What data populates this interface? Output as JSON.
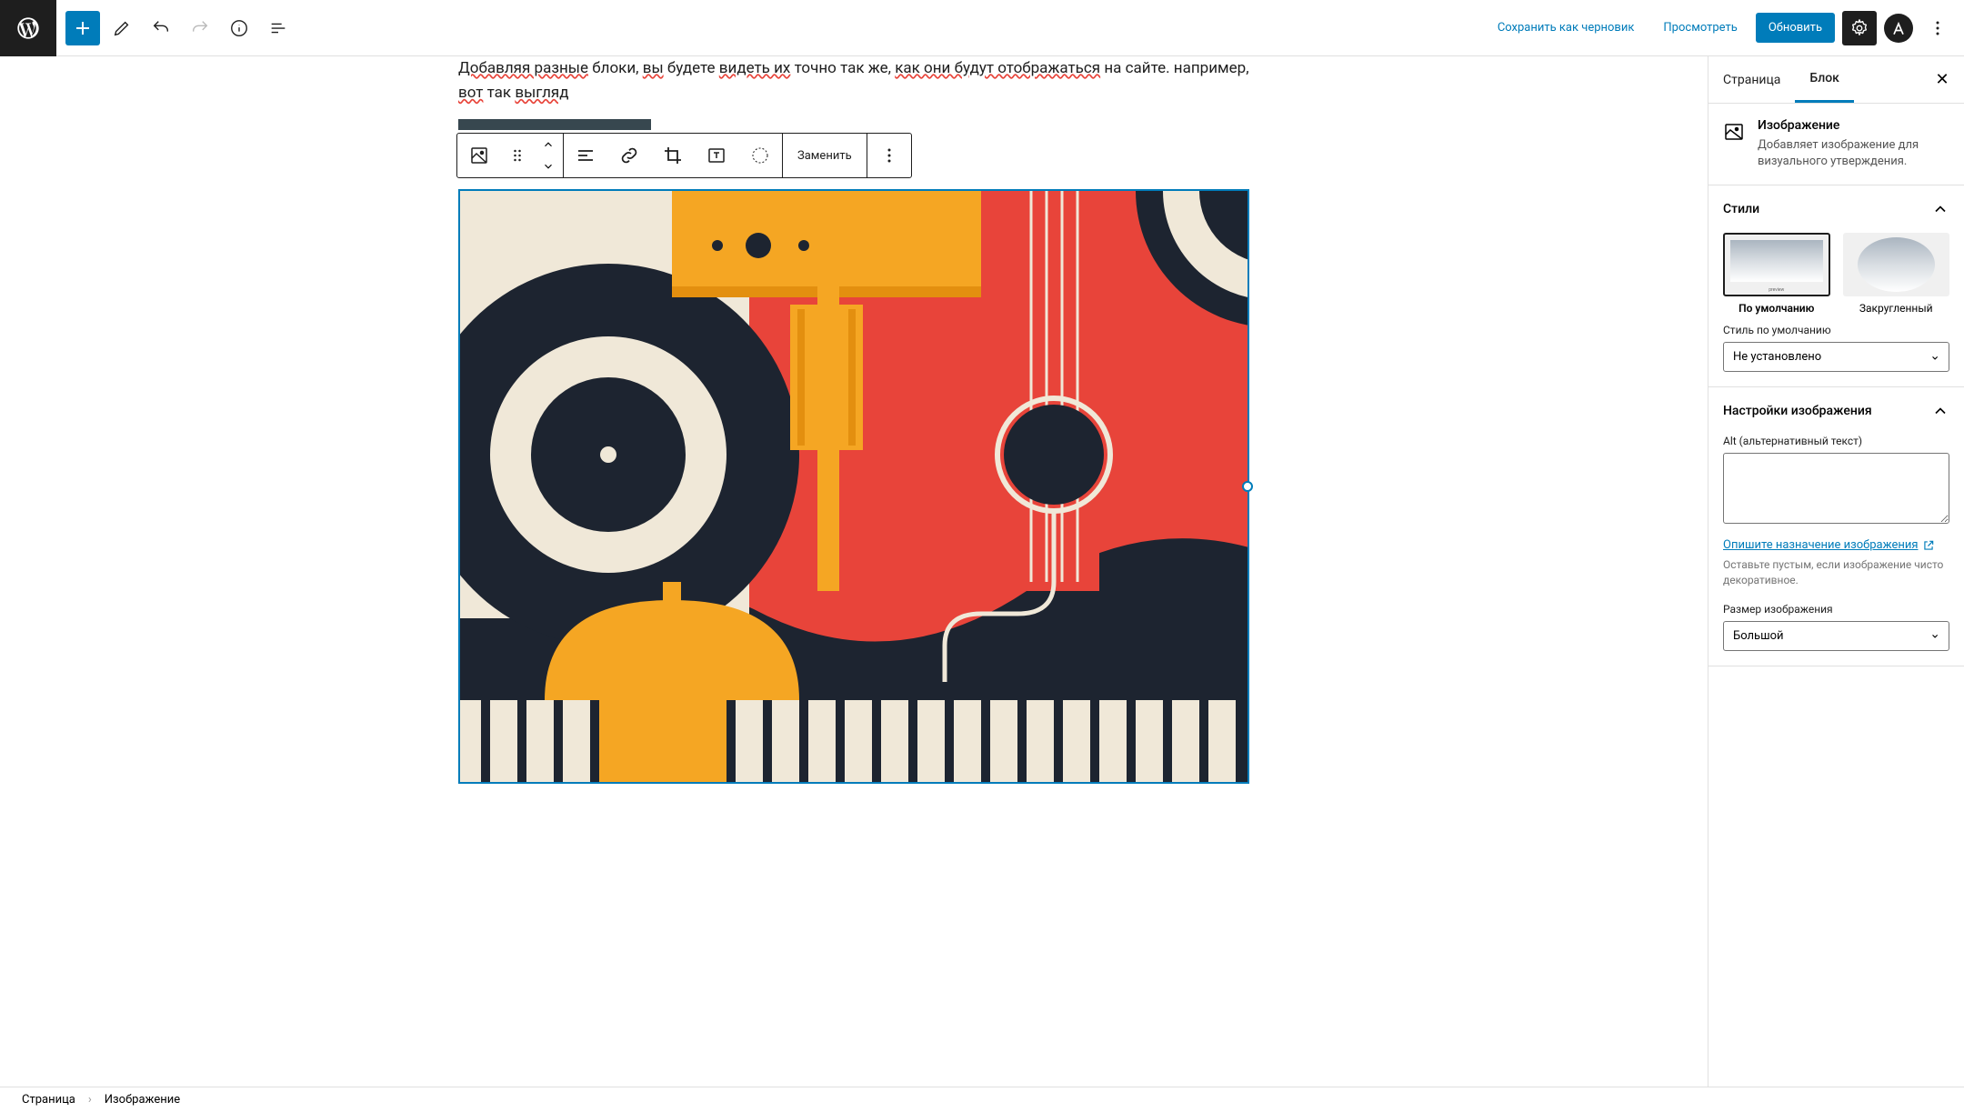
{
  "topbar": {
    "save_draft": "Сохранить как черновик",
    "preview": "Просмотреть",
    "update": "Обновить"
  },
  "editor": {
    "paragraph_words": [
      "Добавляя разные",
      " блоки, ",
      "вы",
      " будете ",
      "видеть их",
      " точно так же, ",
      "как они будут отображаться",
      " на сайте. например, ",
      "вот",
      " так ",
      "выгляд"
    ],
    "replace_label": "Заменить"
  },
  "sidebar": {
    "tabs": {
      "page": "Страница",
      "block": "Блок"
    },
    "block_info": {
      "title": "Изображение",
      "desc": "Добавляет изображение для визуального утверждения."
    },
    "styles": {
      "title": "Стили",
      "default": "По умолчанию",
      "rounded": "Закругленный",
      "default_style_label": "Стиль по умолчанию",
      "default_style_value": "Не установлено"
    },
    "image_settings": {
      "title": "Настройки изображения",
      "alt_label": "Alt (альтернативный текст)",
      "alt_link": "Опишите назначение изображения",
      "alt_help": "Оставьте пустым, если изображение чисто декоративное.",
      "size_label": "Размер изображения",
      "size_value": "Большой"
    }
  },
  "footer": {
    "page": "Страница",
    "current": "Изображение"
  }
}
